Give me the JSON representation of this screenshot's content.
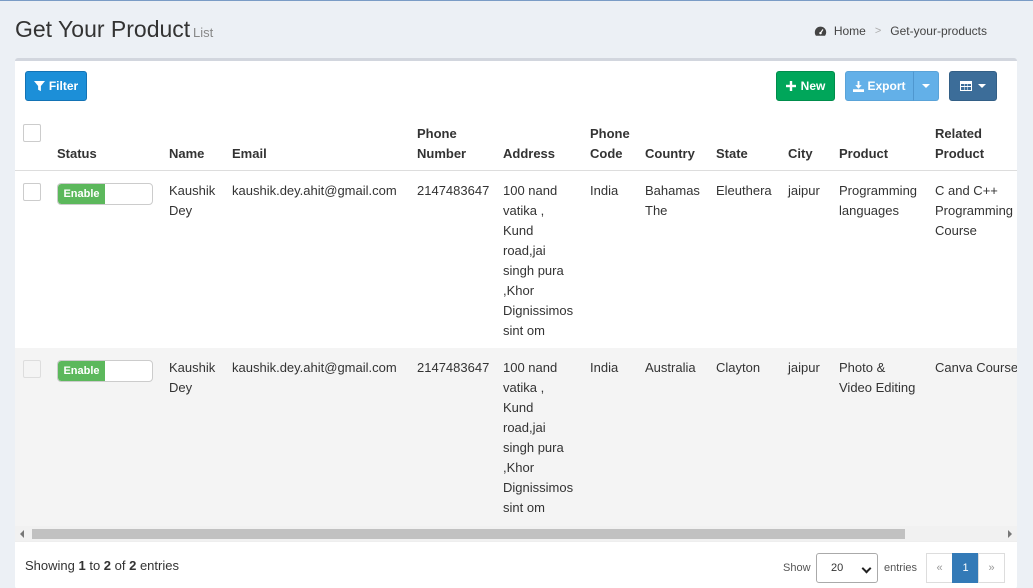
{
  "header": {
    "title": "Get Your Product",
    "subtitle": "List",
    "breadcrumb": {
      "home": "Home",
      "current": "Get-your-products"
    }
  },
  "toolbar": {
    "filter_label": "Filter",
    "new_label": "New",
    "export_label": "Export"
  },
  "table": {
    "columns": {
      "status": "Status",
      "name": "Name",
      "email": "Email",
      "phone_1": "Phone",
      "phone_2": "Number",
      "address": "Address",
      "phone_code_1": "Phone",
      "phone_code_2": "Code",
      "country": "Country",
      "state": "State",
      "city": "City",
      "product": "Product",
      "related_1": "Related",
      "related_2": "Product"
    },
    "rows": [
      {
        "status": "Enable",
        "name": [
          "Kaushik",
          "Dey"
        ],
        "email": "kaushik.dey.ahit@gmail.com",
        "phone": "2147483647",
        "address": [
          "100 nand",
          "vatika ,",
          "Kund",
          "road,jai",
          "singh pura",
          ",Khor",
          "Dignissimos",
          "sint om"
        ],
        "phone_code": "India",
        "country": [
          "Bahamas",
          "The"
        ],
        "state": "Eleuthera",
        "city": "jaipur",
        "product": [
          "Programming",
          "languages"
        ],
        "related": [
          "C and C++",
          "Programming",
          "Course"
        ]
      },
      {
        "status": "Enable",
        "name": [
          "Kaushik",
          "Dey"
        ],
        "email": "kaushik.dey.ahit@gmail.com",
        "phone": "2147483647",
        "address": [
          "100 nand",
          "vatika ,",
          "Kund",
          "road,jai",
          "singh pura",
          ",Khor",
          "Dignissimos",
          "sint om"
        ],
        "phone_code": "India",
        "country": [
          "Australia"
        ],
        "state": "Clayton",
        "city": "jaipur",
        "product": [
          "Photo &",
          "Video Editing"
        ],
        "related": [
          "Canva Course"
        ]
      }
    ]
  },
  "footer": {
    "showing_prefix": "Showing ",
    "from": "1",
    "to_word": " to ",
    "to": "2",
    "of_word": " of ",
    "total": "2",
    "suffix": " entries",
    "show_label": "Show",
    "page_size": "20",
    "entries_label": "entries",
    "prev": "«",
    "page": "1",
    "next": "»"
  },
  "colors": {
    "primary": "#1c8fd8",
    "success": "#00a65a",
    "export": "#63b0e8",
    "columns_btn": "#3c6d99",
    "toggle_on": "#5cb85c"
  },
  "icons": [
    "filter-icon",
    "plus-icon",
    "download-icon",
    "table-columns-icon",
    "dashboard-icon"
  ]
}
